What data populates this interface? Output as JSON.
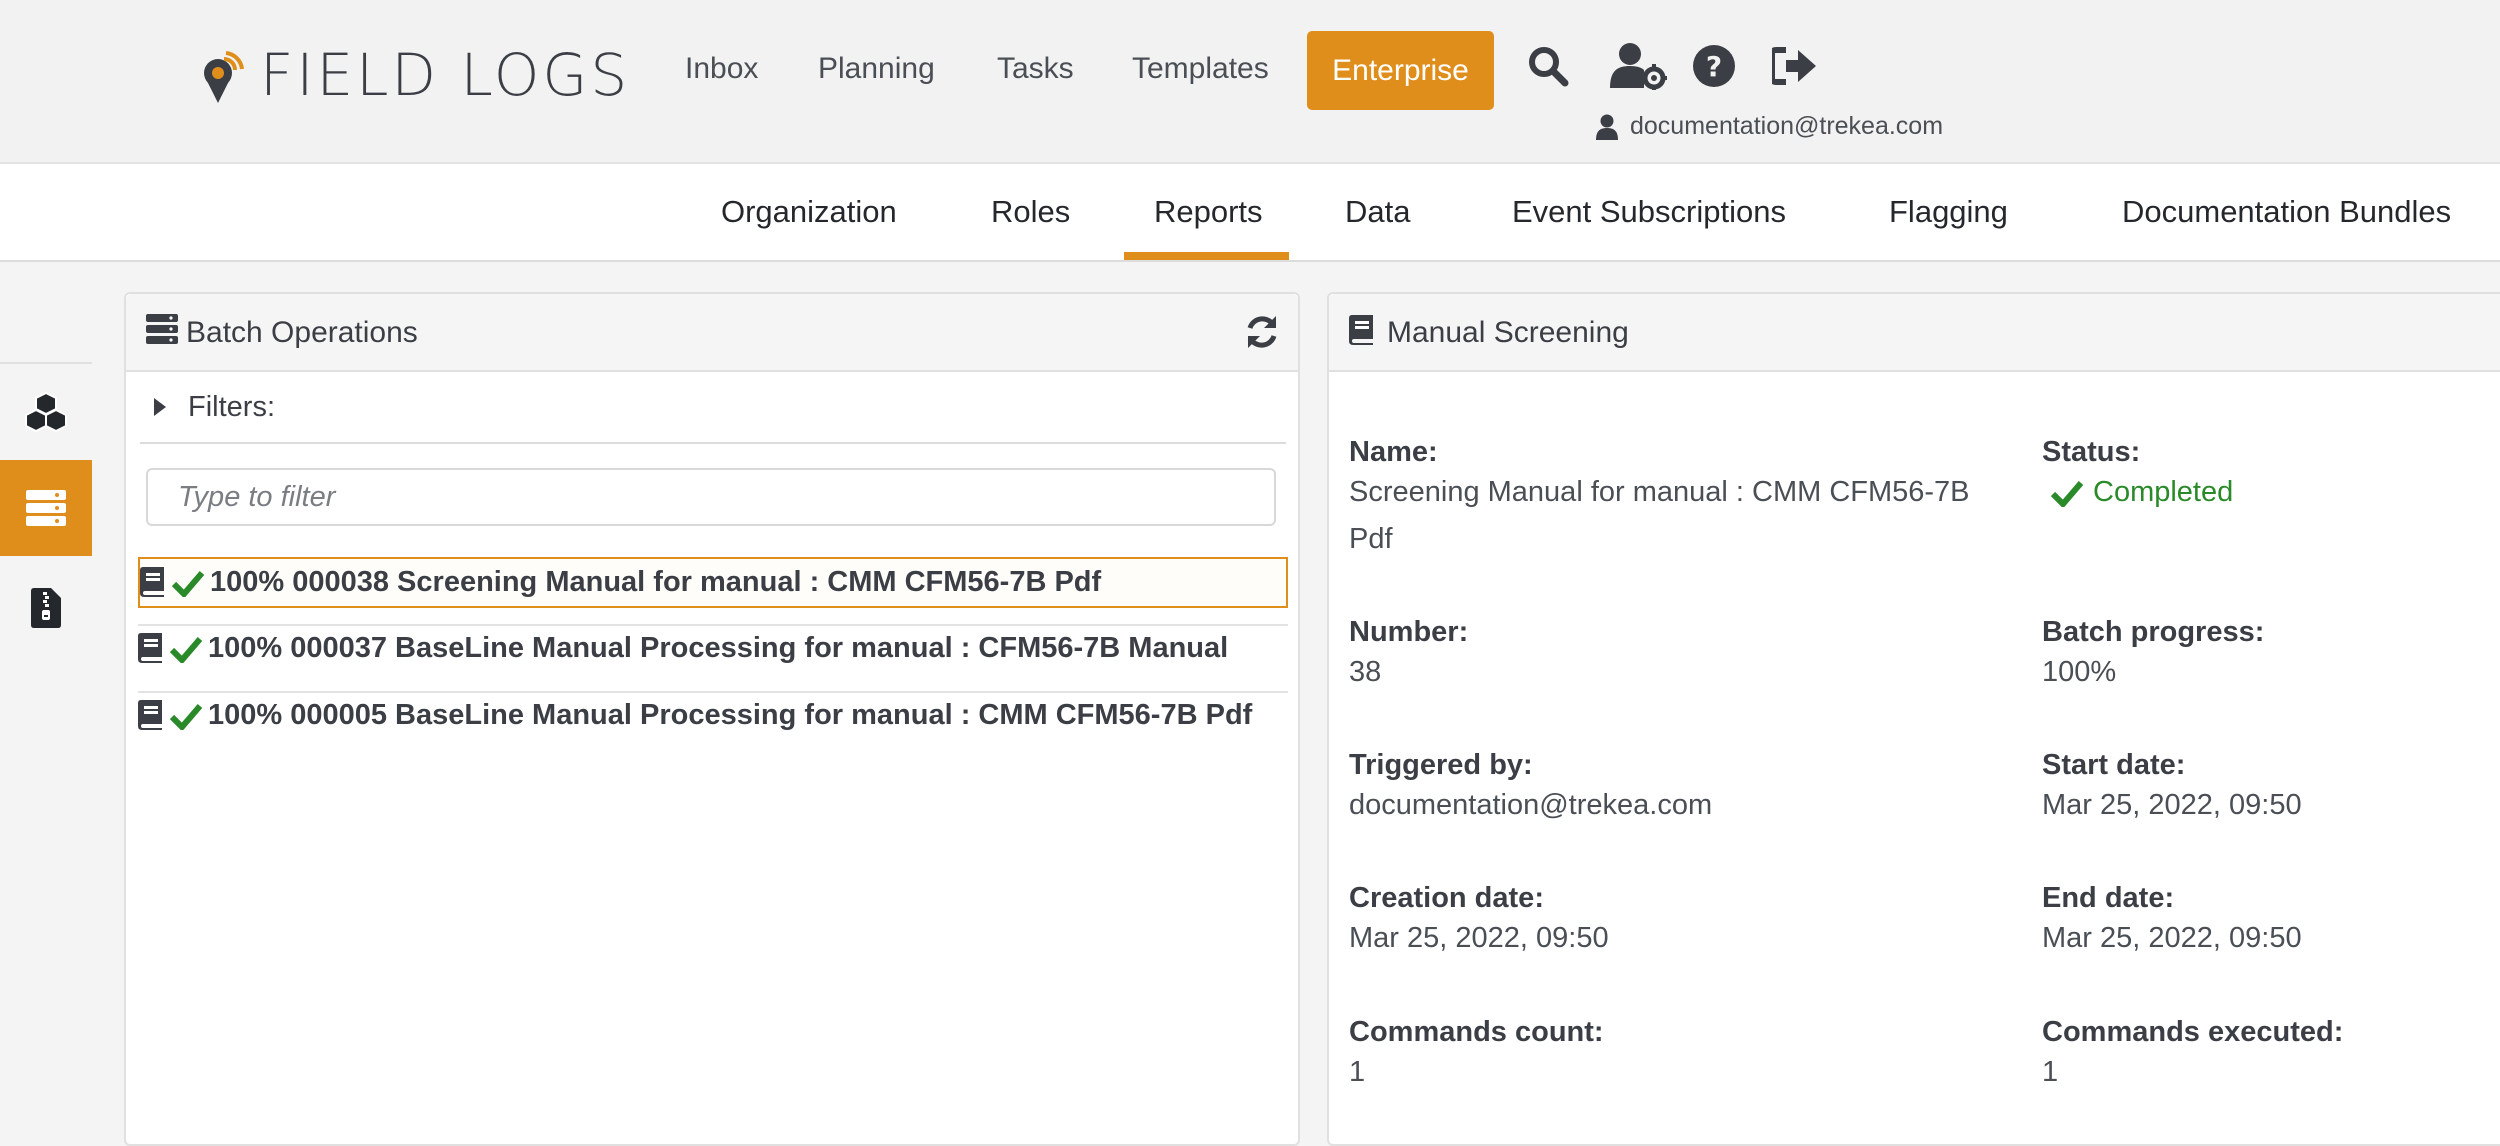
{
  "app": {
    "logo_text": "FIELD LOGS"
  },
  "topnav": {
    "items": [
      "Inbox",
      "Planning",
      "Tasks",
      "Templates"
    ],
    "enterprise": "Enterprise",
    "user_email": "documentation@trekea.com"
  },
  "subnav": {
    "tabs": [
      "Organization",
      "Roles",
      "Reports",
      "Data",
      "Event Subscriptions",
      "Flagging",
      "Documentation Bundles"
    ],
    "active": "Reports"
  },
  "sidebar": {
    "icons": [
      "cubes-icon",
      "server-icon",
      "file-zip-icon"
    ],
    "active": "server-icon"
  },
  "batch_panel": {
    "title": "Batch Operations",
    "filters_label": "Filters:",
    "filter_placeholder": "Type to filter",
    "items": [
      {
        "text": "100% 000038 Screening Manual for manual : CMM CFM56-7B Pdf",
        "selected": true
      },
      {
        "text": "100% 000037 BaseLine Manual Processing for manual : CFM56-7B Manual",
        "selected": false
      },
      {
        "text": "100% 000005 BaseLine Manual Processing for manual : CMM CFM56-7B Pdf",
        "selected": false
      }
    ]
  },
  "detail_panel": {
    "title": "Manual Screening",
    "fields": {
      "name_label": "Name:",
      "name_value": "Screening Manual for manual : CMM CFM56-7B Pdf",
      "status_label": "Status:",
      "status_value": "Completed",
      "number_label": "Number:",
      "number_value": "38",
      "progress_label": "Batch progress:",
      "progress_value": "100%",
      "triggered_label": "Triggered by:",
      "triggered_value": "documentation@trekea.com",
      "start_label": "Start date:",
      "start_value": "Mar 25, 2022, 09:50",
      "creation_label": "Creation date:",
      "creation_value": "Mar 25, 2022, 09:50",
      "end_label": "End date:",
      "end_value": "Mar 25, 2022, 09:50",
      "cmd_count_label": "Commands count:",
      "cmd_count_value": "1",
      "cmd_exec_label": "Commands executed:",
      "cmd_exec_value": "1"
    }
  },
  "colors": {
    "accent": "#e08e1b",
    "success": "#2a8a2a",
    "text": "#3b3f45"
  }
}
